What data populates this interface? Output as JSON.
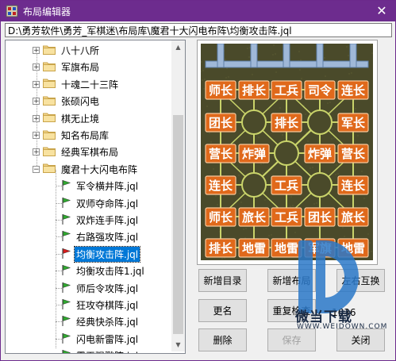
{
  "window": {
    "title": "布局编辑器",
    "close_glyph": "✕"
  },
  "path": "D:\\勇芳软件\\勇芳_军棋迷\\布局库\\魔君十大闪电布阵\\均衡攻击阵.jql",
  "tree": {
    "folders": [
      "八十八所",
      "军旗布局",
      "十魂二十三阵",
      "张硕闪电",
      "棋无止境",
      "知名布局库",
      "经典军棋布局",
      "魔君十大闪电布阵"
    ],
    "files": [
      "军令横井阵.jql",
      "双师夺命阵.jql",
      "双炸连手阵.jql",
      "右路强攻阵.jql",
      "均衡攻击阵.jql",
      "均衡攻击阵1.jql",
      "师后令攻阵.jql",
      "狂攻夺棋阵.jql",
      "经典快杀阵.jql",
      "闪电新雷阵.jql",
      "霸王强戮阵.jql"
    ],
    "selected_file": "均衡攻击阵.jql",
    "expand_plus": "+",
    "expand_minus": "−"
  },
  "board": {
    "rows": [
      [
        "师长",
        "排长",
        "工兵",
        "司令",
        "连长"
      ],
      [
        "团长",
        "",
        "排长",
        "",
        "军长"
      ],
      [
        "营长",
        "炸弹",
        "",
        "炸弹",
        "营长"
      ],
      [
        "连长",
        "",
        "工兵",
        "",
        "连长"
      ],
      [
        "师长",
        "旅长",
        "工兵",
        "团长",
        "旅长"
      ],
      [
        "排长",
        "地雷",
        "地雷",
        "军旗",
        "地雷"
      ]
    ]
  },
  "buttons": {
    "new_folder": "新增目录",
    "new_layout": "新增布局",
    "swap": "左右互换",
    "rename": "更名",
    "reset": "重复检查",
    "delete": "删除",
    "save": "保存",
    "close": "关闭"
  },
  "count": "1636",
  "watermark": {
    "text": "微当下载",
    "url": "WWW.WEIDOWN.COM"
  },
  "colors": {
    "titlebar": "#6d2c8e",
    "piece": "#e0691b",
    "board": "#4a4a2a",
    "selection": "#0078d7"
  }
}
